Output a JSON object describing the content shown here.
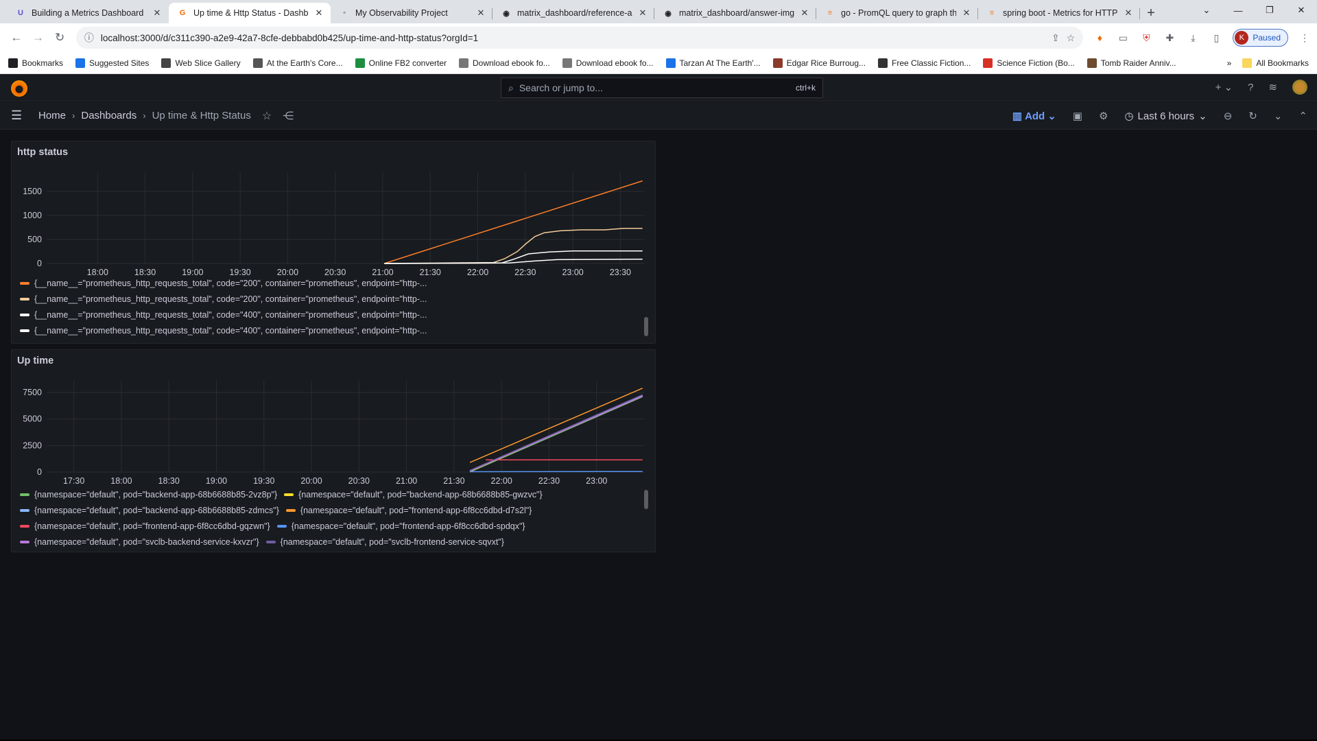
{
  "browser": {
    "tabs": [
      {
        "title": "Building a Metrics Dashboard",
        "favicon": "U",
        "color": "#5b4fcf"
      },
      {
        "title": "Up time & Http Status - Dashbo",
        "favicon": "G",
        "color": "#f46800",
        "active": true
      },
      {
        "title": "My Observability Project",
        "favicon": "•",
        "color": "#9aa0a6"
      },
      {
        "title": "matrix_dashboard/reference-ap",
        "favicon": "◉",
        "color": "#202124"
      },
      {
        "title": "matrix_dashboard/answer-img",
        "favicon": "◉",
        "color": "#202124"
      },
      {
        "title": "go - PromQL query to graph th",
        "favicon": "≡",
        "color": "#f48024"
      },
      {
        "title": "spring boot - Metrics for HTTP",
        "favicon": "≡",
        "color": "#f48024"
      }
    ],
    "url": "localhost:3000/d/c311c390-a2e9-42a7-8cfe-debbabd0b425/up-time-and-http-status?orgId=1",
    "profile_status": "Paused",
    "profile_initial": "K",
    "bookmarks": [
      {
        "label": "Bookmarks",
        "icon": "star-icon",
        "color": "#202124"
      },
      {
        "label": "Suggested Sites",
        "icon": "b-icon",
        "color": "#1a73e8"
      },
      {
        "label": "Web Slice Gallery",
        "icon": "w-icon",
        "color": "#444"
      },
      {
        "label": "At the Earth's Core...",
        "icon": "book-icon",
        "color": "#555"
      },
      {
        "label": "Online FB2 converter",
        "icon": "x-icon",
        "color": "#1e8e3e"
      },
      {
        "label": "Download ebook fo...",
        "icon": "g-icon",
        "color": "#777"
      },
      {
        "label": "Download ebook fo...",
        "icon": "g-icon",
        "color": "#777"
      },
      {
        "label": "Tarzan At The Earth'...",
        "icon": "fb-icon",
        "color": "#1a73e8"
      },
      {
        "label": "Edgar Rice Burroug...",
        "icon": "book-icon",
        "color": "#8b3a2a"
      },
      {
        "label": "Free Classic Fiction...",
        "icon": "globe-icon",
        "color": "#333"
      },
      {
        "label": "Science Fiction (Bo...",
        "icon": "sf-icon",
        "color": "#d93025"
      },
      {
        "label": "Tomb Raider Anniv...",
        "icon": "tr-icon",
        "color": "#6d4c2f"
      }
    ],
    "all_bookmarks": "All Bookmarks"
  },
  "grafana": {
    "search_placeholder": "Search or jump to...",
    "search_shortcut": "ctrl+k",
    "breadcrumbs": [
      "Home",
      "Dashboards",
      "Up time & Http Status"
    ],
    "add_label": "Add",
    "time_range": "Last 6 hours"
  },
  "panels": [
    {
      "title": "http status",
      "chart_data": {
        "type": "line",
        "y_ticks": [
          0,
          500,
          1000,
          1500
        ],
        "ylim": [
          0,
          1900
        ],
        "x_ticks": [
          "18:00",
          "18:30",
          "19:00",
          "19:30",
          "20:00",
          "20:30",
          "21:00",
          "21:30",
          "22:00",
          "22:30",
          "23:00",
          "23:30"
        ],
        "x_range_minutes": [
          1050,
          1425
        ],
        "grid": true,
        "legend_position": "bottom",
        "series": [
          {
            "name": "{__name__=\"prometheus_http_requests_total\", code=\"200\", container=\"prometheus\", endpoint=\"http-...",
            "color": "#ff7f2a",
            "points": [
              [
                1261,
                0
              ],
              [
                1424,
                1720
              ]
            ]
          },
          {
            "name": "{__name__=\"prometheus_http_requests_total\", code=\"200\", container=\"prometheus\", endpoint=\"http-...",
            "color": "#f2cc9a",
            "points": [
              [
                1261,
                0
              ],
              [
                1330,
                20
              ],
              [
                1337,
                100
              ],
              [
                1345,
                250
              ],
              [
                1350,
                400
              ],
              [
                1356,
                560
              ],
              [
                1362,
                640
              ],
              [
                1372,
                680
              ],
              [
                1385,
                700
              ],
              [
                1400,
                700
              ],
              [
                1412,
                730
              ],
              [
                1424,
                730
              ]
            ]
          },
          {
            "name": "{__name__=\"prometheus_http_requests_total\", code=\"400\", container=\"prometheus\", endpoint=\"http-...",
            "color": "#ffffff",
            "points": [
              [
                1261,
                0
              ],
              [
                1335,
                10
              ],
              [
                1342,
                80
              ],
              [
                1352,
                200
              ],
              [
                1365,
                240
              ],
              [
                1380,
                260
              ],
              [
                1424,
                260
              ]
            ]
          },
          {
            "name": "{__name__=\"prometheus_http_requests_total\", code=\"400\", container=\"prometheus\", endpoint=\"http-...",
            "color": "#ffffff",
            "points": [
              [
                1261,
                0
              ],
              [
                1340,
                10
              ],
              [
                1355,
                50
              ],
              [
                1370,
                80
              ],
              [
                1424,
                90
              ]
            ]
          }
        ]
      }
    },
    {
      "title": "Up time",
      "chart_data": {
        "type": "line",
        "y_ticks": [
          0,
          2500,
          5000,
          7500
        ],
        "ylim": [
          0,
          8600
        ],
        "x_ticks": [
          "17:30",
          "18:00",
          "18:30",
          "19:00",
          "19:30",
          "20:00",
          "20:30",
          "21:00",
          "21:30",
          "22:00",
          "22:30",
          "23:00"
        ],
        "x_range_minutes": [
          1035,
          1410
        ],
        "grid": true,
        "legend_position": "bottom",
        "series": [
          {
            "name": "{namespace=\"default\", pod=\"backend-app-68b6688b85-2vz8p\"}",
            "color": "#73bf69",
            "points": [
              [
                1300,
                0
              ],
              [
                1409,
                7100
              ]
            ]
          },
          {
            "name": "{namespace=\"default\", pod=\"backend-app-68b6688b85-gwzvc\"}",
            "color": "#fade2a",
            "points": [
              [
                1300,
                80
              ],
              [
                1409,
                7200
              ]
            ]
          },
          {
            "name": "{namespace=\"default\", pod=\"backend-app-68b6688b85-zdmcs\"}",
            "color": "#8ab8ff",
            "points": [
              [
                1300,
                120
              ],
              [
                1409,
                7250
              ]
            ]
          },
          {
            "name": "{namespace=\"default\", pod=\"frontend-app-6f8cc6dbd-d7s2l\"}",
            "color": "#ff9830",
            "points": [
              [
                1300,
                900
              ],
              [
                1409,
                7900
              ]
            ]
          },
          {
            "name": "{namespace=\"default\", pod=\"frontend-app-6f8cc6dbd-gqzwn\"}",
            "color": "#f2495c",
            "points": [
              [
                1310,
                1150
              ],
              [
                1409,
                1150
              ]
            ]
          },
          {
            "name": "{namespace=\"default\", pod=\"frontend-app-6f8cc6dbd-spdqx\"}",
            "color": "#5794f2",
            "points": [
              [
                1300,
                30
              ],
              [
                1409,
                50
              ]
            ]
          },
          {
            "name": "{namespace=\"default\", pod=\"svclb-backend-service-kxvzr\"}",
            "color": "#b877d9",
            "points": [
              [
                1300,
                100
              ],
              [
                1409,
                7150
              ]
            ]
          },
          {
            "name": "{namespace=\"default\", pod=\"svclb-frontend-service-sqvxt\"}",
            "color": "#705da0",
            "points": [
              [
                1300,
                150
              ],
              [
                1409,
                7280
              ]
            ]
          }
        ]
      }
    }
  ]
}
